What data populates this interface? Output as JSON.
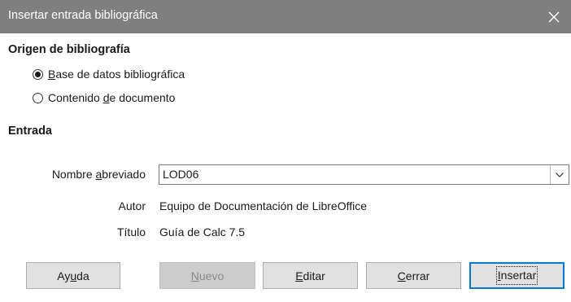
{
  "dialog": {
    "title": "Insertar entrada bibliográfica",
    "close_glyph": "✕"
  },
  "origin": {
    "heading": "Origen de bibliografía",
    "options": [
      {
        "pre": "",
        "key": "B",
        "post": "ase de datos bibliográfica",
        "checked": true
      },
      {
        "pre": "Contenido ",
        "key": "d",
        "post": "e documento",
        "checked": false
      }
    ]
  },
  "entry": {
    "heading": "Entrada",
    "short_name": {
      "pre": "Nombre ",
      "key": "a",
      "post": "breviado",
      "value": "LOD06"
    },
    "author_label": "Autor",
    "author_value": "Equipo de Documentación de LibreOffice",
    "title_label": "Título",
    "title_value": "Guía de Calc 7.5"
  },
  "buttons": {
    "help": {
      "pre": "Ay",
      "key": "u",
      "post": "da"
    },
    "new": {
      "pre": "",
      "key": "N",
      "post": "uevo",
      "disabled": true
    },
    "edit": {
      "pre": "",
      "key": "E",
      "post": "ditar"
    },
    "close": {
      "pre": "",
      "key": "C",
      "post": "errar"
    },
    "insert": {
      "pre": "",
      "key": "I",
      "post": "nsertar",
      "default": true
    }
  },
  "icons": {
    "close": "close-icon",
    "dropdown": "chevron-down-icon"
  }
}
